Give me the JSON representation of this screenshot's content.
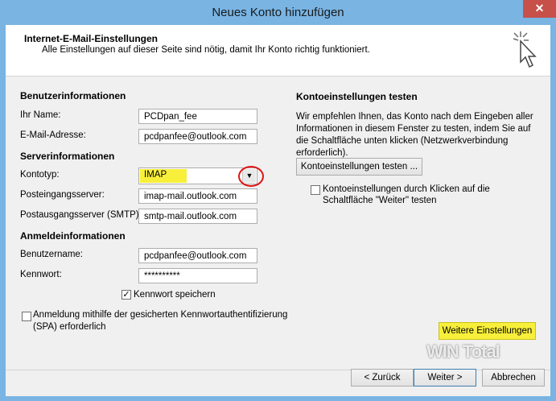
{
  "window": {
    "title": "Neues Konto hinzufügen",
    "close_glyph": "✕"
  },
  "header": {
    "title": "Internet-E-Mail-Einstellungen",
    "subtitle": "Alle Einstellungen auf dieser Seite sind nötig, damit Ihr Konto richtig funktioniert.",
    "icon": "cursor-click-icon"
  },
  "user_info": {
    "section": "Benutzerinformationen",
    "name_label": "Ihr Name:",
    "name_value": "PCDpan_fee",
    "email_label": "E-Mail-Adresse:",
    "email_value": "pcdpanfee@outlook.com"
  },
  "server_info": {
    "section": "Serverinformationen",
    "account_type_label": "Kontotyp:",
    "account_type_value": "IMAP",
    "incoming_label": "Posteingangsserver:",
    "incoming_value": "imap-mail.outlook.com",
    "outgoing_label": "Postausgangsserver (SMTP):",
    "outgoing_value": "smtp-mail.outlook.com"
  },
  "login_info": {
    "section": "Anmeldeinformationen",
    "username_label": "Benutzername:",
    "username_value": "pcdpanfee@outlook.com",
    "password_label": "Kennwort:",
    "password_value": "**********",
    "remember_label": "Kennwort speichern",
    "remember_checked": true,
    "spa_label_line1": "Anmeldung mithilfe der gesicherten Kennwortauthentifizierung",
    "spa_label_line2": "(SPA) erforderlich",
    "spa_checked": false
  },
  "test": {
    "section": "Kontoeinstellungen testen",
    "description": "Wir empfehlen Ihnen, das Konto nach dem Eingeben aller Informationen in diesem Fenster zu testen, indem Sie auf die Schaltfläche unten klicken (Netzwerkverbindung erforderlich).",
    "test_button": "Kontoeinstellungen testen ...",
    "auto_test_line1": "Kontoeinstellungen durch Klicken auf die",
    "auto_test_line2": "Schaltfläche \"Weiter\" testen",
    "auto_test_checked": false
  },
  "more_settings_button": "Weitere Einstellungen",
  "footer": {
    "back": "< Zurück",
    "next": "Weiter >",
    "cancel": "Abbrechen"
  },
  "watermark": "WIN Total",
  "colors": {
    "highlight": "#f7ef3a",
    "ring": "#e01414",
    "titlebar": "#79b4e3",
    "close": "#c7504a"
  }
}
